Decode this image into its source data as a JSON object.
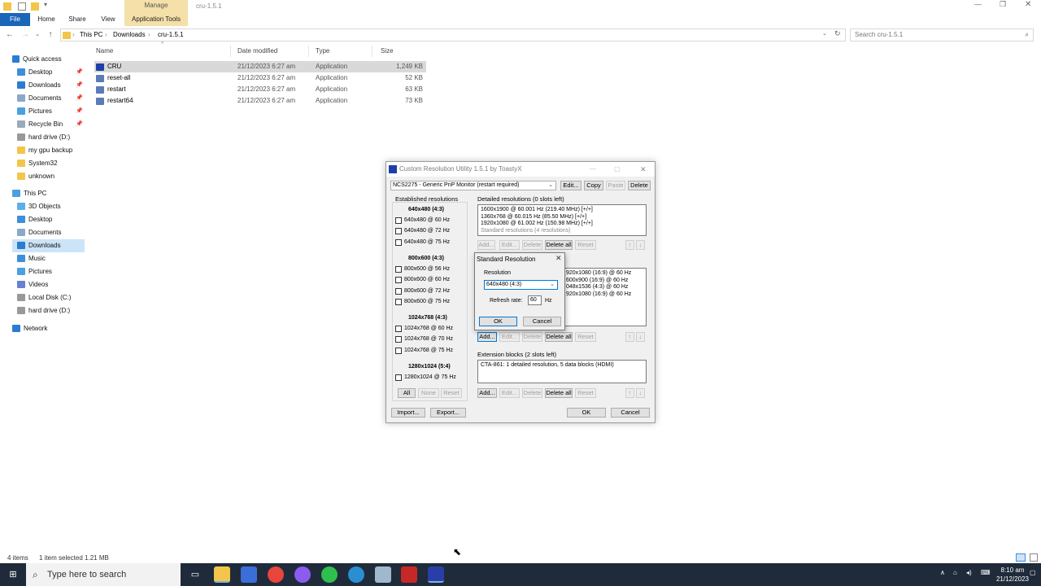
{
  "explorer": {
    "title": "cru-1.5.1",
    "ribbon": {
      "file": "File",
      "home": "Home",
      "share": "Share",
      "view": "View",
      "manage": "Manage",
      "app_tools": "Application Tools"
    },
    "breadcrumb": [
      "This PC",
      "Downloads",
      "cru-1.5.1"
    ],
    "search_placeholder": "Search cru-1.5.1",
    "sidebar": {
      "quick_access": "Quick access",
      "items": [
        "Desktop",
        "Downloads",
        "Documents",
        "Pictures",
        "Recycle Bin",
        "hard drive (D:)",
        "my gpu backup",
        "System32",
        "unknown"
      ],
      "this_pc": "This PC",
      "pc_items": [
        "3D Objects",
        "Desktop",
        "Documents",
        "Downloads",
        "Music",
        "Pictures",
        "Videos",
        "Local Disk (C:)",
        "hard drive (D:)"
      ],
      "network": "Network"
    },
    "columns": [
      "Name",
      "Date modified",
      "Type",
      "Size"
    ],
    "files": [
      {
        "name": "CRU",
        "date": "21/12/2023 6:27 am",
        "type": "Application",
        "size": "1,249 KB"
      },
      {
        "name": "reset-all",
        "date": "21/12/2023 6:27 am",
        "type": "Application",
        "size": "52 KB"
      },
      {
        "name": "restart",
        "date": "21/12/2023 6:27 am",
        "type": "Application",
        "size": "63 KB"
      },
      {
        "name": "restart64",
        "date": "21/12/2023 6:27 am",
        "type": "Application",
        "size": "73 KB"
      }
    ],
    "status": {
      "items": "4 items",
      "selected": "1 item selected  1.21 MB"
    }
  },
  "cru": {
    "title": "Custom Resolution Utility 1.5.1 by ToastyX",
    "monitor": "NCS2275 - Generic PnP Monitor (restart required)",
    "top_buttons": [
      "Edit...",
      "Copy",
      "Paste",
      "Delete"
    ],
    "established_label": "Established resolutions",
    "established_groups": [
      {
        "header": "640x480 (4:3)",
        "items": [
          "640x480 @ 60 Hz",
          "640x480 @ 72 Hz",
          "640x480 @ 75 Hz"
        ]
      },
      {
        "header": "800x600 (4:3)",
        "items": [
          "800x600 @ 56 Hz",
          "800x600 @ 60 Hz",
          "800x600 @ 72 Hz",
          "800x600 @ 75 Hz"
        ]
      },
      {
        "header": "1024x768 (4:3)",
        "items": [
          "1024x768 @ 60 Hz",
          "1024x768 @ 70 Hz",
          "1024x768 @ 75 Hz"
        ]
      },
      {
        "header": "1280x1024 (5:4)",
        "items": [
          "1280x1024 @ 75 Hz"
        ]
      }
    ],
    "est_buttons": [
      "All",
      "None",
      "Reset"
    ],
    "detailed_label": "Detailed resolutions (0 slots left)",
    "detailed_items": [
      "1600x1900 @ 60.001 Hz (219.40 MHz) [+/+]",
      "1360x768 @ 60.015 Hz (85.50 MHz) [+/+]",
      "1920x1080 @ 61.002 Hz (150.98 MHz) [+/+]",
      "Standard resolutions (4 resolutions)"
    ],
    "standard_items": [
      "920x1080 (16:9) @ 60 Hz",
      "600x900 (16:9) @ 60 Hz",
      "048x1536 (4:3) @ 60 Hz",
      "920x1080 (16:9) @ 60 Hz"
    ],
    "row_buttons": [
      "Add...",
      "Edit...",
      "Delete",
      "Delete all",
      "Reset"
    ],
    "extension_label": "Extension blocks (2 slots left)",
    "extension_items": [
      "CTA-861: 1 detailed resolution, 5 data blocks (HDMI)"
    ],
    "bottom_buttons": {
      "import": "Import...",
      "export": "Export...",
      "ok": "OK",
      "cancel": "Cancel"
    }
  },
  "dialog": {
    "title": "Standard Resolution",
    "resolution_label": "Resolution",
    "resolution_value": "640x480 (4:3)",
    "refresh_label": "Refresh rate:",
    "refresh_value": "60",
    "refresh_unit": "Hz",
    "ok": "OK",
    "cancel": "Cancel"
  },
  "taskbar": {
    "search": "Type here to search",
    "time": "8:10 am",
    "date": "21/12/2023"
  },
  "colors": {
    "accent": "#0078d7",
    "file_tab": "#1a66b8",
    "manage": "#f4e0a8",
    "taskbar": "#1f2b3a"
  }
}
